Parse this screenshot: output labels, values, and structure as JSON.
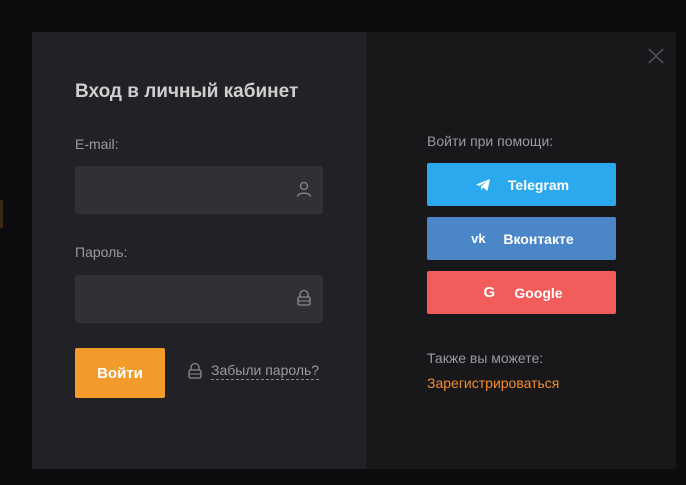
{
  "login": {
    "title": "Вход в личный кабинет",
    "email_label": "E-mail:",
    "email_value": "",
    "password_label": "Пароль:",
    "password_value": "",
    "submit_label": "Войти",
    "forgot_label": "Забыли пароль?"
  },
  "social": {
    "heading": "Войти при помощи:",
    "buttons": [
      {
        "label": "Telegram",
        "icon": "telegram-icon",
        "color": "#2aa9ee"
      },
      {
        "label": "Вконтакте",
        "icon": "vk-icon",
        "color": "#4b86c9"
      },
      {
        "label": "Google",
        "icon": "google-icon",
        "color": "#f25c5a"
      }
    ],
    "also_label": "Также вы можете:",
    "register_label": "Зарегистрироваться"
  },
  "colors": {
    "accent": "#f29b2a",
    "link": "#f28c2f",
    "left_panel": "#212126",
    "right_panel": "#18181b",
    "field_bg": "#303037"
  }
}
